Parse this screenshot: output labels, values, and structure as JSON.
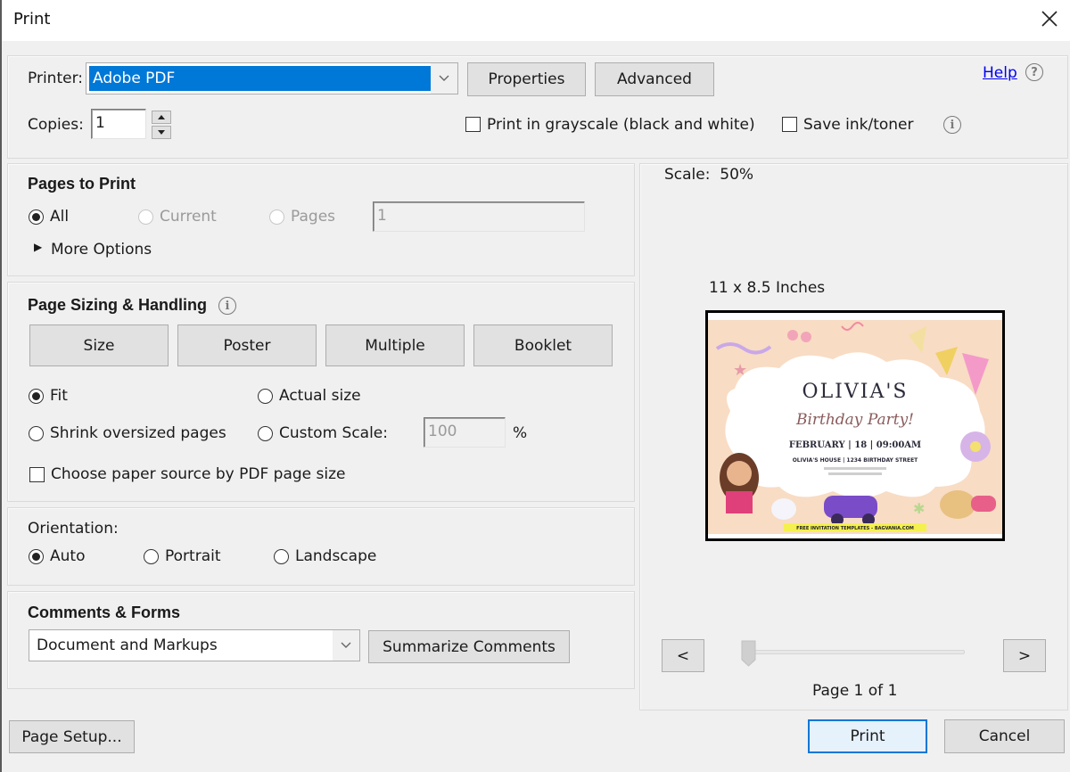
{
  "window": {
    "title": "Print",
    "close_icon": "close-icon"
  },
  "printer": {
    "label": "Printer:",
    "selected": "Adobe PDF",
    "properties_label": "Properties",
    "advanced_label": "Advanced",
    "help_label": "Help",
    "copies_label": "Copies:",
    "copies_value": "1",
    "grayscale_label": "Print in grayscale (black and white)",
    "grayscale_checked": false,
    "save_ink_label": "Save ink/toner",
    "save_ink_checked": false
  },
  "pages_to_print": {
    "heading": "Pages to Print",
    "options": [
      {
        "label": "All",
        "checked": true,
        "enabled": true
      },
      {
        "label": "Current",
        "checked": false,
        "enabled": false
      },
      {
        "label": "Pages",
        "checked": false,
        "enabled": false
      }
    ],
    "pages_value": "1",
    "more_options_label": "More Options"
  },
  "page_sizing": {
    "heading": "Page Sizing & Handling",
    "tabs": [
      "Size",
      "Poster",
      "Multiple",
      "Booklet"
    ],
    "fit_label": "Fit",
    "fit_checked": true,
    "actual_size_label": "Actual size",
    "shrink_label": "Shrink oversized pages",
    "custom_scale_label": "Custom Scale:",
    "custom_scale_value": "100",
    "percent_label": "%",
    "paper_source_label": "Choose paper source by PDF page size",
    "paper_source_checked": false
  },
  "orientation": {
    "heading": "Orientation:",
    "options": [
      {
        "label": "Auto",
        "checked": true
      },
      {
        "label": "Portrait",
        "checked": false
      },
      {
        "label": "Landscape",
        "checked": false
      }
    ]
  },
  "comments_forms": {
    "heading": "Comments & Forms",
    "selected": "Document and Markups",
    "summarize_label": "Summarize Comments"
  },
  "preview": {
    "scale_label": "Scale:  50%",
    "page_size_label": "11 x 8.5 Inches",
    "doc": {
      "title": "OLIVIA'S",
      "subtitle": "Birthday Party!",
      "date_line": "FEBRUARY | 18 | 09:00AM",
      "venue_line": "OLIVIA'S HOUSE | 1234 BIRTHDAY STREET",
      "footer": "FREE INVITATION TEMPLATES - BAGVANIA.COM"
    },
    "prev_label": "<",
    "next_label": ">",
    "page_indicator": "Page 1 of 1",
    "slider_position": 0
  },
  "footer": {
    "page_setup_label": "Page Setup...",
    "print_label": "Print",
    "cancel_label": "Cancel"
  },
  "colors": {
    "selection": "#0078d7",
    "dialog_bg": "#f0f0f0",
    "link": "#0000ee"
  }
}
